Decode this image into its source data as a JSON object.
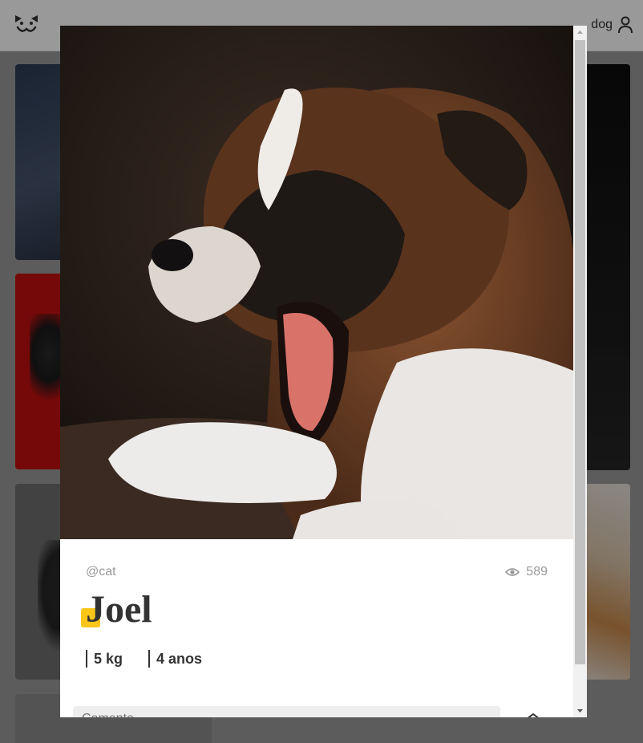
{
  "header": {
    "username": "dog",
    "logo_icon": "dog-face-logo-icon",
    "user_icon": "user-icon"
  },
  "modal": {
    "photo_alt": "Joel",
    "author": "@cat",
    "views": "589",
    "views_icon": "eye-icon",
    "title": "Joel",
    "weight": "5 kg",
    "age": "4 anos",
    "comment_placeholder": "Comente...",
    "send_icon": "send-icon"
  },
  "colors": {
    "accent": "#fbc51a",
    "text": "#333333",
    "muted": "#999999",
    "input_bg": "#eeeeee"
  }
}
